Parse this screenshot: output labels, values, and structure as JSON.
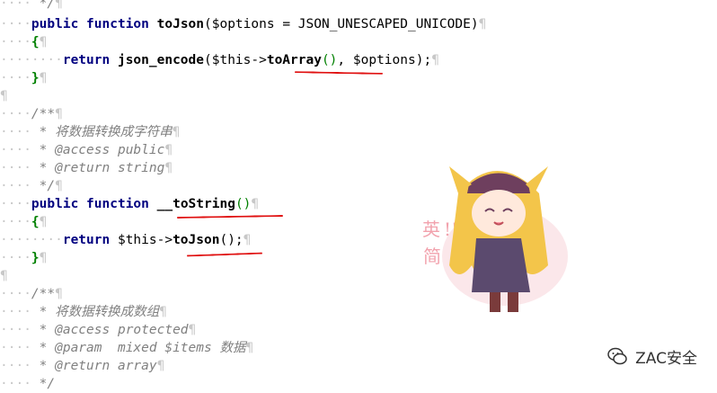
{
  "code": {
    "l01": " */",
    "l02_kw1": "public",
    "l02_kw2": "function",
    "l02_name": "toJson",
    "l02_args": "($options = JSON_UNESCAPED_UNICODE)",
    "brace_open": "{",
    "brace_close": "}",
    "l04_kw": "return",
    "l04_call": "json_encode",
    "l04_args_a": "($this->",
    "l04_hl": "toArray",
    "l04_paren": "()",
    "l04_args_b": ", $options);",
    "doc_open": "/**",
    "l08": " * 将数据转换成字符串",
    "l09_tag": " * @access",
    "l09_val": " public",
    "l10_tag": " * @return",
    "l10_val": " string",
    "doc_close": " */",
    "l12_name": "__toString",
    "l12_paren": "()",
    "l14_kw": "return",
    "l14_a": "$this->",
    "l14_hl": "toJson",
    "l14_b": "();",
    "l18": " * 将数据转换成数组",
    "l19_tag": " * @access",
    "l19_val": " protected",
    "l20_tag": " * @param",
    "l20_val": "  mixed $items 数据",
    "l21_tag": " * @return",
    "l21_val": " array",
    "pilcrow": "¶"
  },
  "stamp_text": "英 !! 简",
  "watermark": {
    "text": "ZAC安全",
    "icon": "wechat-icon"
  },
  "colors": {
    "keyword": "#000080",
    "comment": "#808080",
    "highlight": "#008000",
    "annotation": "#e01010"
  }
}
